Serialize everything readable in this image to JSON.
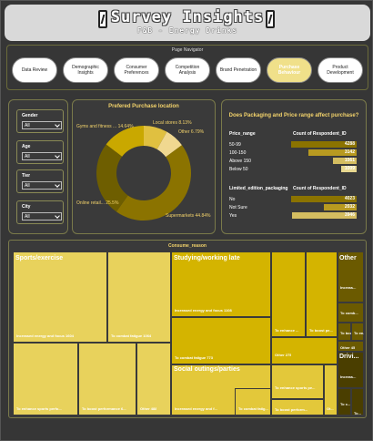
{
  "header": {
    "title": "Survey Insights",
    "subtitle": "F&B - Energy Drinks"
  },
  "nav": {
    "title": "Page Navigator",
    "buttons": [
      {
        "label": "Data Review"
      },
      {
        "label": "Demographic Insights"
      },
      {
        "label": "Consumer Preferences"
      },
      {
        "label": "Competition Analysis"
      },
      {
        "label": "Brand Penetration"
      },
      {
        "label": "Purchase Behaviour"
      },
      {
        "label": "Product Development"
      }
    ],
    "active_index": 5
  },
  "filters": [
    {
      "label": "Gender",
      "value": "All"
    },
    {
      "label": "Age",
      "value": "All"
    },
    {
      "label": "Tier",
      "value": "All"
    },
    {
      "label": "City",
      "value": "All"
    }
  ],
  "donut": {
    "title": "Prefered Purchase location",
    "slices": [
      {
        "name": "Supermarkets",
        "label": "Supermarkets 44.84%",
        "value": 44.84,
        "color": "#8b7300"
      },
      {
        "name": "Online retail...",
        "label": "Online retail... 25.5%",
        "value": 25.5,
        "color": "#6e5e00"
      },
      {
        "name": "Gyms and fitness",
        "label": "Gyms and fitness ... 14.64%",
        "value": 14.64,
        "color": "#c9a800"
      },
      {
        "name": "Local stores",
        "label": "Local stores 8.13%",
        "value": 8.13,
        "color": "#e0c040"
      },
      {
        "name": "Other",
        "label": "Other 6.79%",
        "value": 6.79,
        "color": "#f0d890"
      }
    ]
  },
  "packaging": {
    "title": "Does Packaging and Price range affect purchase?",
    "price_head": "Price_range",
    "count_head": "Count of Respondent_ID",
    "price_rows": [
      {
        "label": "50-99",
        "value": 4288
      },
      {
        "label": "100-150",
        "value": 3142
      },
      {
        "label": "Above 150",
        "value": 1561
      },
      {
        "label": "Below 50",
        "value": 1009
      }
    ],
    "pack_head": "Limited_edition_packaging",
    "pack_count_head": "Count of Respondent_ID",
    "pack_rows": [
      {
        "label": "No",
        "value": 4023
      },
      {
        "label": "Not Sure",
        "value": 2032
      },
      {
        "label": "Yes",
        "value": 3946
      }
    ]
  },
  "treemap": {
    "title": "Consume_reason",
    "groups": [
      {
        "name": "Sports/exercise"
      },
      {
        "name": "Studying/working late"
      },
      {
        "name": "Social outings/parties"
      },
      {
        "name": "Other"
      },
      {
        "name": "Drivi..."
      }
    ],
    "cells": [
      {
        "label": "Increased energy and focus 1604"
      },
      {
        "label": "To combat fatigue 1064"
      },
      {
        "label": "To enhance sports perfo..."
      },
      {
        "label": "To boost performance 6..."
      },
      {
        "label": "Other 488"
      },
      {
        "label": "Increased energy and focus 1108"
      },
      {
        "label": "To combat fatigue 773"
      },
      {
        "label": "To enhance ..."
      },
      {
        "label": "To boost pe..."
      },
      {
        "label": "Other 275"
      },
      {
        "label": "Increased energy and f..."
      },
      {
        "label": "To combat fatig..."
      },
      {
        "label": "To enhance sports pe..."
      },
      {
        "label": "To boost perform..."
      },
      {
        "label": "Ot..."
      },
      {
        "label": "Increas..."
      },
      {
        "label": "To comb..."
      },
      {
        "label": "To boost..."
      },
      {
        "label": "To en..."
      },
      {
        "label": "Other 45"
      },
      {
        "label": "Increas..."
      },
      {
        "label": "To c..."
      },
      {
        "label": "To..."
      }
    ]
  }
}
